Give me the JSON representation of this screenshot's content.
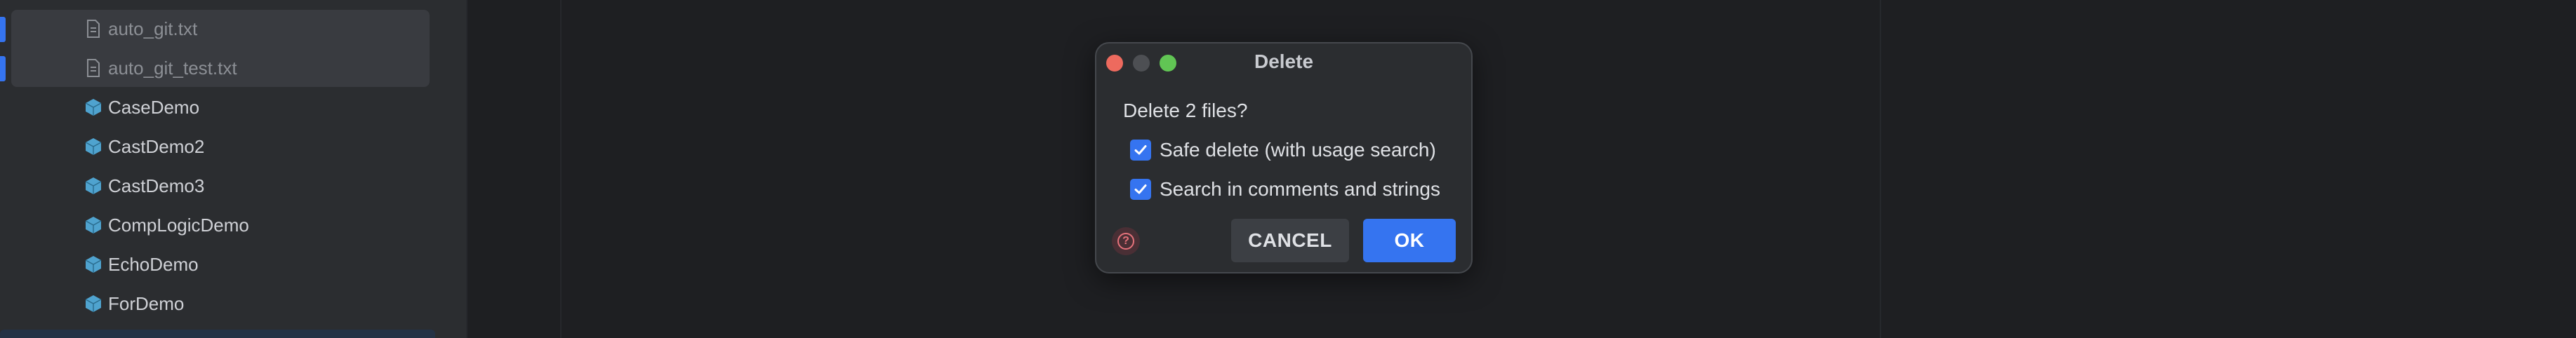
{
  "project_tree": {
    "items": [
      {
        "label": "auto_git.txt",
        "icon": "text-file-icon",
        "selected": true
      },
      {
        "label": "auto_git_test.txt",
        "icon": "text-file-icon",
        "selected": true
      },
      {
        "label": "CaseDemo",
        "icon": "java-class-icon",
        "selected": false
      },
      {
        "label": "CastDemo2",
        "icon": "java-class-icon",
        "selected": false
      },
      {
        "label": "CastDemo3",
        "icon": "java-class-icon",
        "selected": false
      },
      {
        "label": "CompLogicDemo",
        "icon": "java-class-icon",
        "selected": false
      },
      {
        "label": "EchoDemo",
        "icon": "java-class-icon",
        "selected": false
      },
      {
        "label": "ForDemo",
        "icon": "java-class-icon",
        "selected": false
      }
    ]
  },
  "dialog": {
    "title": "Delete",
    "question": "Delete 2 files?",
    "options": [
      {
        "label": "Safe delete (with usage search)",
        "checked": true
      },
      {
        "label": "Search in comments and strings",
        "checked": true
      }
    ],
    "cancel_label": "CANCEL",
    "ok_label": "OK",
    "help_icon": "help-icon"
  },
  "colors": {
    "accent": "#3574f0",
    "close": "#ed6a5e",
    "maximize": "#61c554",
    "help": "#e5737b"
  }
}
